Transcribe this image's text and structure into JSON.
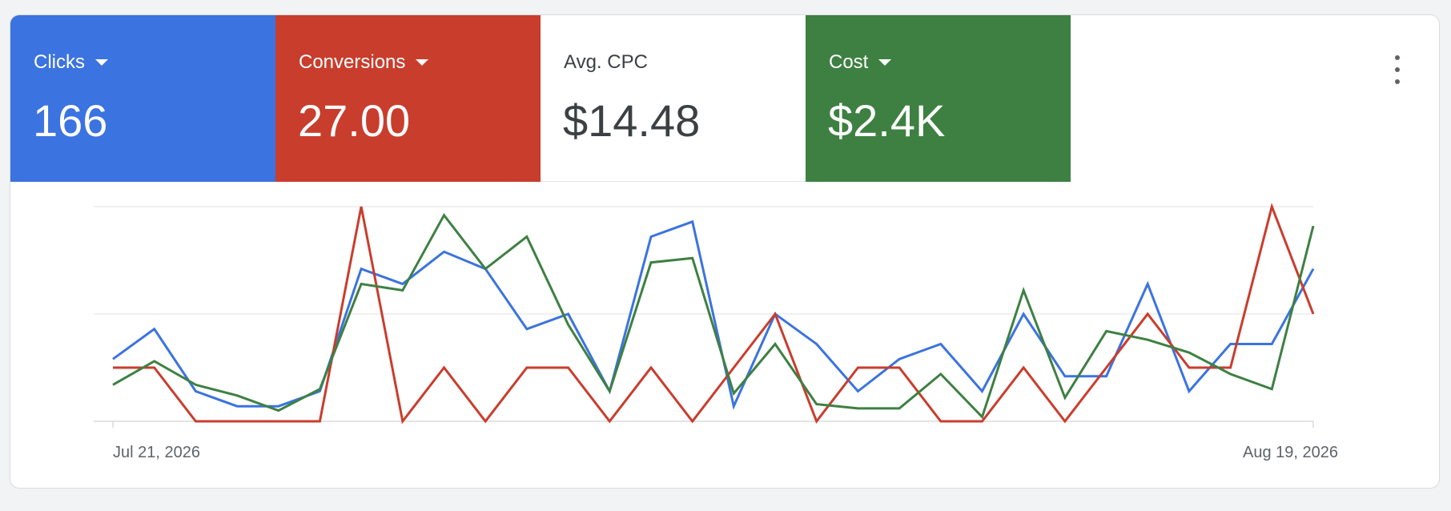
{
  "metrics": {
    "clicks": {
      "label": "Clicks",
      "value": "166",
      "color": "#3b73e0"
    },
    "conversions": {
      "label": "Conversions",
      "value": "27.00",
      "color": "#c93d2d"
    },
    "avg_cpc": {
      "label": "Avg. CPC",
      "value": "$14.48",
      "color": "#ffffff"
    },
    "cost": {
      "label": "Cost",
      "value": "$2.4K",
      "color": "#3e8042"
    }
  },
  "more_icon": "more-vert-icon",
  "chart_data": {
    "type": "line",
    "grid": true,
    "legend": "none",
    "x_tick_labels": [
      "Jul 21, 2026",
      "Aug 19, 2026"
    ],
    "x": [
      "Jul 21, 2026",
      "Jul 22, 2026",
      "Jul 23, 2026",
      "Jul 24, 2026",
      "Jul 25, 2026",
      "Jul 26, 2026",
      "Jul 27, 2026",
      "Jul 28, 2026",
      "Jul 29, 2026",
      "Jul 30, 2026",
      "Jul 31, 2026",
      "Aug 1, 2026",
      "Aug 2, 2026",
      "Aug 3, 2026",
      "Aug 4, 2026",
      "Aug 5, 2026",
      "Aug 6, 2026",
      "Aug 7, 2026",
      "Aug 8, 2026",
      "Aug 9, 2026",
      "Aug 10, 2026",
      "Aug 11, 2026",
      "Aug 12, 2026",
      "Aug 13, 2026",
      "Aug 14, 2026",
      "Aug 15, 2026",
      "Aug 16, 2026",
      "Aug 17, 2026",
      "Aug 18, 2026",
      "Aug 19, 2026"
    ],
    "ylim": [
      0,
      1
    ],
    "series": [
      {
        "color": "#3b73e0",
        "values": [
          0.29,
          0.43,
          0.14,
          0.07,
          0.07,
          0.14,
          0.71,
          0.64,
          0.79,
          0.71,
          0.43,
          0.5,
          0.14,
          0.86,
          0.93,
          0.07,
          0.5,
          0.36,
          0.14,
          0.29,
          0.36,
          0.14,
          0.5,
          0.21,
          0.21,
          0.64,
          0.14,
          0.36,
          0.36,
          0.71
        ]
      },
      {
        "color": "#c93d2d",
        "values": [
          0.25,
          0.25,
          0.0,
          0.0,
          0.0,
          0.0,
          1.0,
          0.0,
          0.25,
          0.0,
          0.25,
          0.25,
          0.0,
          0.25,
          0.0,
          0.25,
          0.5,
          0.0,
          0.25,
          0.25,
          0.0,
          0.0,
          0.25,
          0.0,
          0.25,
          0.5,
          0.25,
          0.25,
          1.0,
          0.5
        ]
      },
      {
        "color": "#3e8042",
        "values": [
          0.17,
          0.28,
          0.17,
          0.12,
          0.05,
          0.15,
          0.64,
          0.61,
          0.96,
          0.71,
          0.86,
          0.45,
          0.14,
          0.74,
          0.76,
          0.13,
          0.36,
          0.08,
          0.06,
          0.06,
          0.22,
          0.02,
          0.61,
          0.11,
          0.42,
          0.38,
          0.32,
          0.22,
          0.15,
          0.91
        ]
      }
    ]
  }
}
